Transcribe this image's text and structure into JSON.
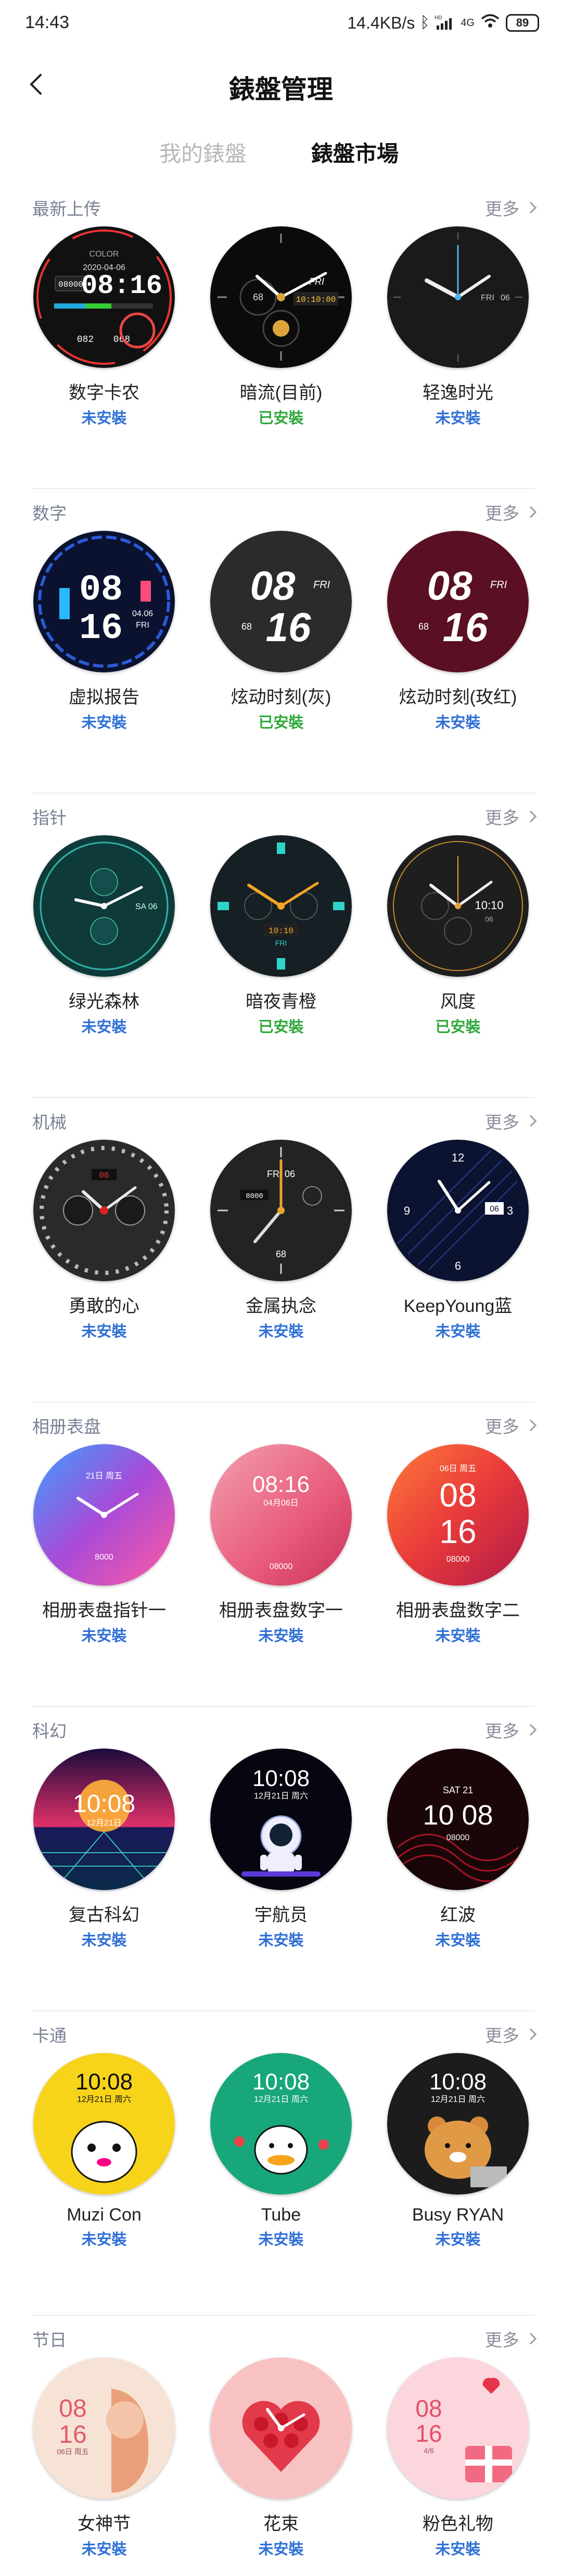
{
  "status_bar": {
    "time": "14:43",
    "speed": "14.4KB/s",
    "network": "4G",
    "battery": "89"
  },
  "header": {
    "title": "錶盤管理"
  },
  "tabs": {
    "mine": "我的錶盤",
    "market": "錶盤市場"
  },
  "more_label": "更多",
  "status_labels": {
    "not_installed": "未安裝",
    "installed": "已安裝"
  },
  "sections": [
    {
      "title": "最新上传",
      "items": [
        {
          "name": "数字卡农",
          "status": "未安裝",
          "installed": false
        },
        {
          "name": "暗流(目前)",
          "status": "已安裝",
          "installed": true
        },
        {
          "name": "轻逸时光",
          "status": "未安裝",
          "installed": false
        }
      ]
    },
    {
      "title": "数字",
      "items": [
        {
          "name": "虚拟报告",
          "status": "未安裝",
          "installed": false
        },
        {
          "name": "炫动时刻(灰)",
          "status": "已安裝",
          "installed": true
        },
        {
          "name": "炫动时刻(玫红)",
          "status": "未安裝",
          "installed": false
        }
      ]
    },
    {
      "title": "指针",
      "items": [
        {
          "name": "绿光森林",
          "status": "未安裝",
          "installed": false
        },
        {
          "name": "暗夜青橙",
          "status": "已安裝",
          "installed": true
        },
        {
          "name": "风度",
          "status": "已安裝",
          "installed": true
        }
      ]
    },
    {
      "title": "机械",
      "items": [
        {
          "name": "勇敢的心",
          "status": "未安裝",
          "installed": false
        },
        {
          "name": "金属执念",
          "status": "未安裝",
          "installed": false
        },
        {
          "name": "KeepYoung蓝",
          "status": "未安裝",
          "installed": false
        }
      ]
    },
    {
      "title": "相册表盘",
      "items": [
        {
          "name": "相册表盘指针一",
          "status": "未安裝",
          "installed": false
        },
        {
          "name": "相册表盘数字一",
          "status": "未安裝",
          "installed": false
        },
        {
          "name": "相册表盘数字二",
          "status": "未安裝",
          "installed": false
        }
      ]
    },
    {
      "title": "科幻",
      "items": [
        {
          "name": "复古科幻",
          "status": "未安裝",
          "installed": false
        },
        {
          "name": "宇航员",
          "status": "未安裝",
          "installed": false
        },
        {
          "name": "红波",
          "status": "未安裝",
          "installed": false
        }
      ]
    },
    {
      "title": "卡通",
      "items": [
        {
          "name": "Muzi Con",
          "status": "未安裝",
          "installed": false
        },
        {
          "name": "Tube",
          "status": "未安裝",
          "installed": false
        },
        {
          "name": "Busy RYAN",
          "status": "未安裝",
          "installed": false
        }
      ]
    },
    {
      "title": "节日",
      "items": [
        {
          "name": "女神节",
          "status": "未安裝",
          "installed": false
        },
        {
          "name": "花束",
          "status": "未安裝",
          "installed": false
        },
        {
          "name": "粉色礼物",
          "status": "未安裝",
          "installed": false
        }
      ]
    }
  ],
  "face_text": {
    "s0_0": {
      "brand": "COLOR",
      "date": "2020-04-06",
      "time": "08:16",
      "steps": "08000",
      "num1": "082",
      "num2": "068"
    },
    "s0_1": {
      "time": "10:10:00",
      "num": "68",
      "day": "FRI"
    },
    "s0_2": {
      "day": "FRI",
      "date": "06"
    },
    "s1_0": {
      "hh": "08",
      "mm": "16",
      "date": "04.06",
      "day": "FRI"
    },
    "s1_1": {
      "hh": "08",
      "mm": "16",
      "day": "FRI",
      "num": "68"
    },
    "s1_2": {
      "hh": "08",
      "mm": "16",
      "day": "FRI",
      "num": "68"
    },
    "s2_0": {
      "date": "SA 06"
    },
    "s2_1": {
      "time": "10:10",
      "day": "FRI"
    },
    "s2_2": {
      "time": "10:10",
      "date": "06"
    },
    "s3_0": {
      "date": "06"
    },
    "s3_1": {
      "day": "FRI 06",
      "steps": "8000",
      "num": "68"
    },
    "s3_2": {
      "num": "06"
    },
    "s4_0": {
      "date": "21日 周五",
      "steps": "8000"
    },
    "s4_1": {
      "time": "08:16",
      "date": "04月06日",
      "steps": "08000"
    },
    "s4_2": {
      "date": "06日 周五",
      "hh": "08",
      "mm": "16",
      "steps": "08000"
    },
    "s5_0": {
      "time": "10:08",
      "date": "12月21日"
    },
    "s5_1": {
      "time": "10:08",
      "date": "12月21日 周六"
    },
    "s5_2": {
      "day": "SAT 21",
      "time": "10 08",
      "steps": "08000"
    },
    "s6_0": {
      "time": "10:08",
      "date": "12月21日 周六"
    },
    "s6_1": {
      "time": "10:08",
      "date": "12月21日 周六"
    },
    "s6_2": {
      "time": "10:08",
      "date": "12月21日 周六"
    },
    "s7_0": {
      "hh": "08",
      "mm": "16",
      "date": "06日 周五"
    },
    "s7_2": {
      "hh": "08",
      "mm": "16",
      "date": "4/6"
    }
  }
}
